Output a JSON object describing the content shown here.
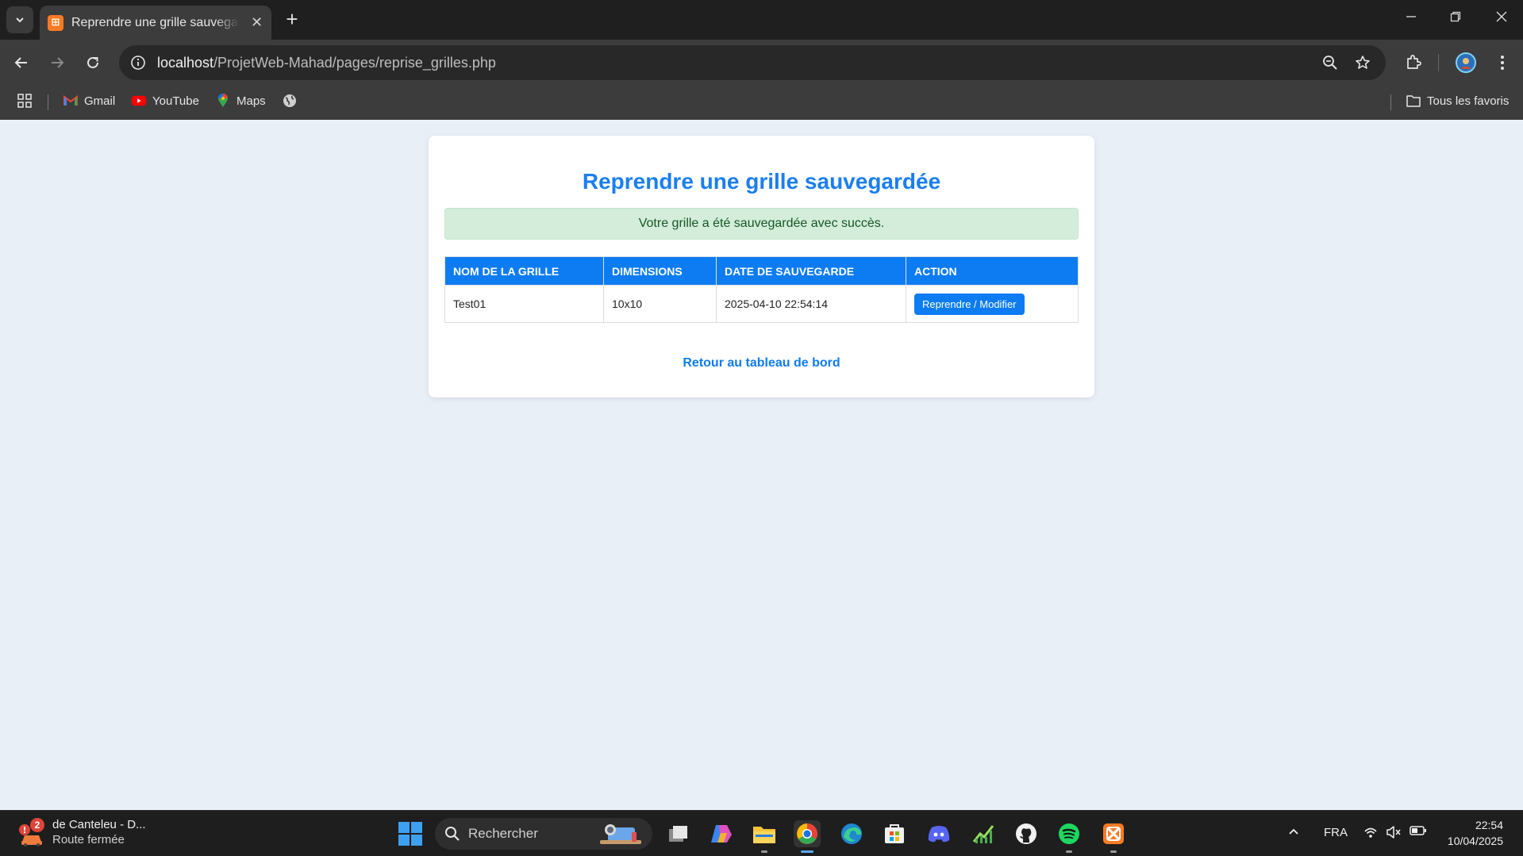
{
  "browser": {
    "tab_title": "Reprendre une grille sauvegardée",
    "tab_favicon_letter": "⊞",
    "url_host": "localhost",
    "url_path": "/ProjetWeb-Mahad/pages/reprise_grilles.php",
    "bookmarks": [
      {
        "label": "Gmail",
        "icon": "gmail-icon"
      },
      {
        "label": "YouTube",
        "icon": "youtube-icon"
      },
      {
        "label": "Maps",
        "icon": "maps-icon"
      }
    ],
    "all_bookmarks_label": "Tous les favoris"
  },
  "page": {
    "title": "Reprendre une grille sauvegardée",
    "alert": "Votre grille a été sauvegardée avec succès.",
    "table": {
      "headers": [
        "NOM DE LA GRILLE",
        "DIMENSIONS",
        "DATE DE SAUVEGARDE",
        "ACTION"
      ],
      "rows": [
        {
          "name": "Test01",
          "dimensions": "10x10",
          "date": "2025-04-10 22:54:14",
          "action": "Reprendre / Modifier"
        }
      ]
    },
    "back_link": "Retour au tableau de bord"
  },
  "taskbar": {
    "weather_badge": "2",
    "weather_title": "de Canteleu - D...",
    "weather_sub": "Route fermée",
    "search_placeholder": "Rechercher",
    "language": "FRA",
    "time": "22:54",
    "date": "10/04/2025"
  },
  "colors": {
    "accent": "#0d7cf2",
    "title": "#1a7ef0",
    "alert_bg": "#d4edda",
    "alert_text": "#155724",
    "page_bg": "#e8eff7"
  }
}
